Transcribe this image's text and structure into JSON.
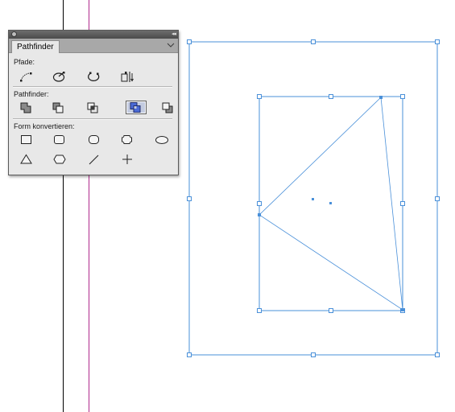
{
  "panel": {
    "tab_label": "Pathfinder",
    "collapse_glyph": "◂◂",
    "menu_glyph": "≡",
    "sections": {
      "paths": "Pfade:",
      "pathfinder": "Pathfinder:",
      "convert_shape": "Form konvertieren:"
    }
  },
  "icons": {
    "paths": [
      "join-path-icon",
      "close-path-icon",
      "open-path-icon",
      "reverse-path-icon"
    ],
    "pathfinder": [
      "add-icon",
      "subtract-icon",
      "intersect-icon",
      "exclude-overlap-icon",
      "minus-back-icon"
    ],
    "convert_shape": [
      "rectangle-icon",
      "rounded-rectangle-icon",
      "beveled-rectangle-icon",
      "inverse-rounded-rectangle-icon",
      "ellipse-icon",
      "triangle-icon",
      "polygon-icon",
      "line-icon",
      "orthogonal-line-icon"
    ]
  },
  "active_tool": "exclude-overlap-icon",
  "colors": {
    "selection_blue": "#4a90d9",
    "margin_guide": "#b02a8c",
    "active_button": "#c3cbe0"
  }
}
